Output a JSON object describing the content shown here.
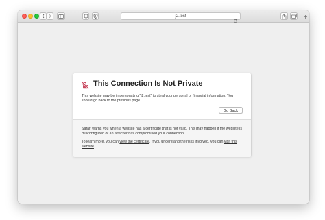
{
  "browser": {
    "url": "j2.test"
  },
  "error_page": {
    "title": "This Connection Is Not Private",
    "message": "This website may be impersonating \"j2.test\" to steal your personal or financial information. You should go back to the previous page.",
    "go_back_label": "Go Back",
    "details": "Safari warns you when a website has a certificate that is not valid. This may happen if the website is misconfigured or an attacker has compromised your connection.",
    "learn_more_prefix": "To learn more, you can ",
    "view_certificate_link": "view the certificate",
    "learn_more_middle": ". If you understand the risks involved, you can ",
    "visit_website_link": "visit this website",
    "learn_more_suffix": "."
  },
  "colors": {
    "warning_icon": "#c8485f",
    "close": "#fe5f57",
    "minimize": "#febc2e",
    "maximize": "#28c840"
  },
  "icons": {
    "back": "chevron-left-icon",
    "forward": "chevron-right-icon",
    "sidebar": "sidebar-icon",
    "privacy": "privacy-report-icon",
    "shield": "shield-icon",
    "reload": "reload-icon",
    "share": "share-icon",
    "tabs": "tab-overview-icon",
    "new_tab": "plus-icon",
    "warning": "unlocked-warning-icon"
  }
}
